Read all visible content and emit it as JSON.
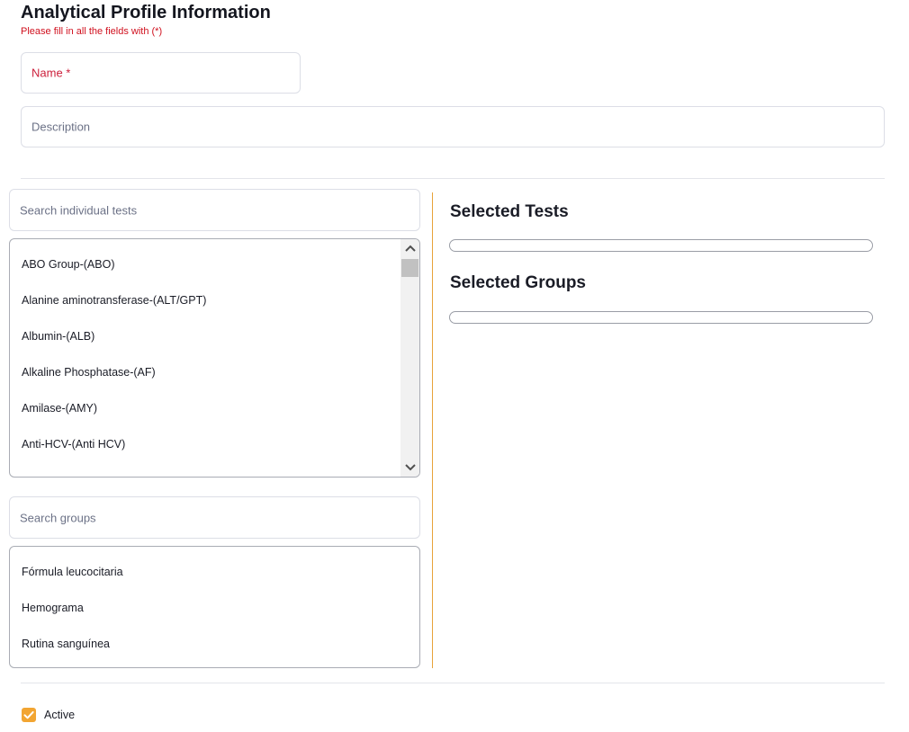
{
  "header": {
    "title": "Analytical Profile Information",
    "required_note": "Please fill in all the fields with (*)"
  },
  "form": {
    "name_placeholder": "Name *",
    "description_placeholder": "Description"
  },
  "tests": {
    "search_placeholder": "Search individual tests",
    "items": [
      "ABO Group-(ABO)",
      "Alanine aminotransferase-(ALT/GPT)",
      "Albumin-(ALB)",
      "Alkaline Phosphatase-(AF)",
      "Amilase-(AMY)",
      "Anti-HCV-(Anti HCV)"
    ]
  },
  "groups": {
    "search_placeholder": "Search groups",
    "items": [
      "Fórmula leucocitaria",
      "Hemograma",
      "Rutina sanguínea"
    ]
  },
  "selected": {
    "tests_title": "Selected Tests",
    "groups_title": "Selected Groups"
  },
  "status": {
    "active_label": "Active",
    "active_checked": true
  },
  "colors": {
    "accent": "#f2a532",
    "required": "#d0101e",
    "divider_vertical": "#e8a33a"
  },
  "icons": {
    "scroll_up": "chevron-up-icon",
    "scroll_down": "chevron-down-icon",
    "checkbox": "checkmark-icon"
  }
}
